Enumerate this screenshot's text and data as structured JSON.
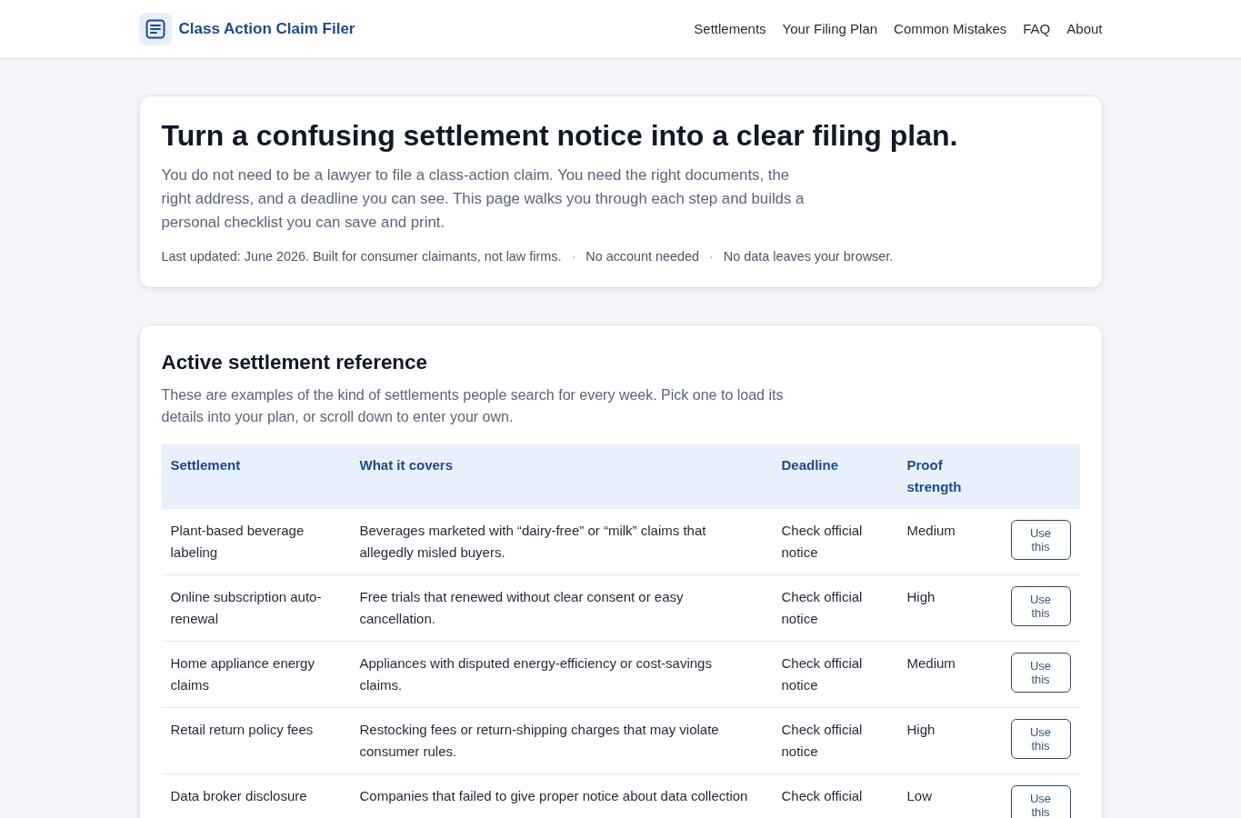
{
  "header": {
    "brand": "Class Action Claim Filer",
    "nav": [
      {
        "label": "Settlements"
      },
      {
        "label": "Your Filing Plan"
      },
      {
        "label": "Common Mistakes"
      },
      {
        "label": "FAQ"
      },
      {
        "label": "About"
      }
    ]
  },
  "hero": {
    "title": "Turn a confusing settlement notice into a clear filing plan.",
    "intro": "You do not need to be a lawyer to file a class-action claim. You need the right documents, the right address, and a deadline you can see. This page walks you through each step and builds a personal checklist you can save and print.",
    "meta": {
      "separator": "·",
      "items": [
        "Last updated: June 2026. Built for consumer claimants, not law firms.",
        "No account needed",
        "No data leaves your browser."
      ]
    }
  },
  "reference": {
    "title": "Active settlement reference",
    "description": "These are examples of the kind of settlements people search for every week. Pick one to load its details into your plan, or scroll down to enter your own.",
    "table": {
      "columns": [
        "Settlement",
        "What it covers",
        "Deadline",
        "Proof strength"
      ],
      "rows": [
        {
          "settlement": "Plant-based beverage labeling",
          "covers": "Beverages marketed with “dairy-free” or “milk” claims that allegedly misled buyers.",
          "deadline": "Check official notice",
          "proof": "Medium",
          "action": "Use this"
        },
        {
          "settlement": "Online subscription auto-renewal",
          "covers": "Free trials that renewed without clear consent or easy cancellation.",
          "deadline": "Check official notice",
          "proof": "High",
          "action": "Use this"
        },
        {
          "settlement": "Home appliance energy claims",
          "covers": "Appliances with disputed energy-efficiency or cost-savings claims.",
          "deadline": "Check official notice",
          "proof": "Medium",
          "action": "Use this"
        },
        {
          "settlement": "Retail return policy fees",
          "covers": "Restocking fees or return-shipping charges that may violate consumer rules.",
          "deadline": "Check official notice",
          "proof": "High",
          "action": "Use this"
        },
        {
          "settlement": "Data broker disclosure",
          "covers": "Companies that failed to give proper notice about data collection",
          "deadline": "Check official",
          "proof": "Low",
          "action": "Use this"
        }
      ]
    }
  }
}
